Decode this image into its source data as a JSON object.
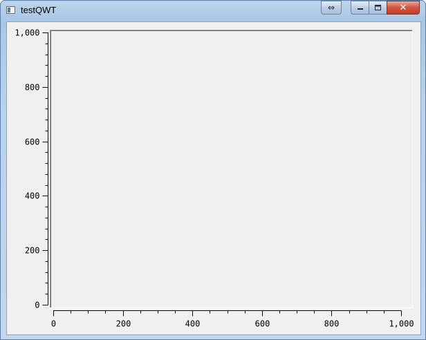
{
  "window": {
    "title": "testQWT",
    "close_glyph": "✕",
    "resize_glyph": "⇔"
  },
  "chart_data": {
    "type": "line",
    "title": "",
    "xlabel": "",
    "ylabel": "",
    "xlim": [
      0,
      1000
    ],
    "ylim": [
      0,
      1000
    ],
    "x_ticks": [
      "0",
      "200",
      "400",
      "600",
      "800",
      "1,000"
    ],
    "y_ticks": [
      "0",
      "200",
      "400",
      "600",
      "800",
      "1,000"
    ],
    "series": [],
    "grid": false
  }
}
